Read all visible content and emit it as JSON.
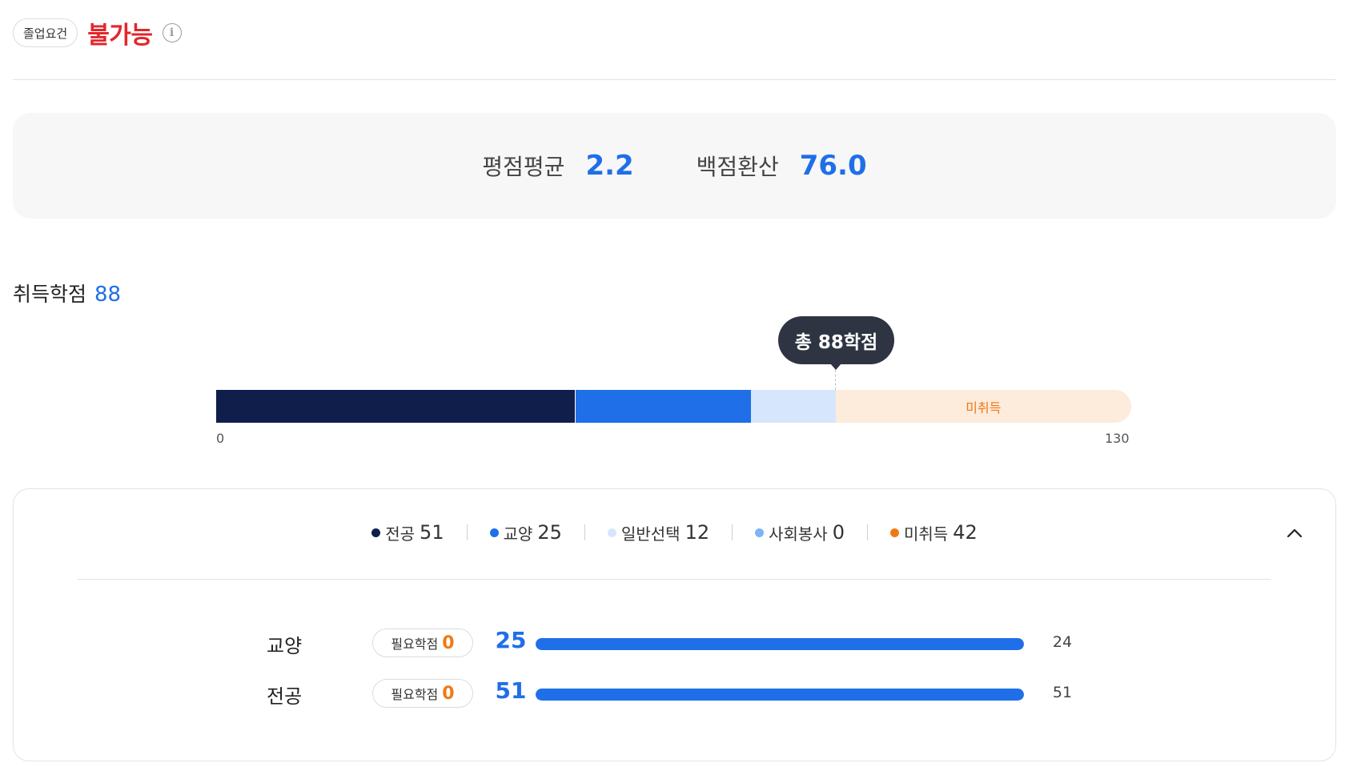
{
  "graduation": {
    "chip_label": "졸업요건",
    "status": "불가능",
    "info_icon": "i"
  },
  "gpa": {
    "average_label": "평점평균",
    "average_value": "2.2",
    "hundred_label": "백점환산",
    "hundred_value": "76.0"
  },
  "earned": {
    "label": "취득학점",
    "value": "88"
  },
  "credit_bar": {
    "tooltip": "총 88학점",
    "missing_label": "미취득",
    "axis_min": "0",
    "axis_max": "130",
    "total": 130,
    "segments": [
      {
        "key": "major",
        "value": 51,
        "color": "#0f1e4b"
      },
      {
        "key": "liberal",
        "value": 25,
        "color": "#1f6fe8"
      },
      {
        "key": "general",
        "value": 12,
        "color": "#d6e6fc"
      },
      {
        "key": "service",
        "value": 0,
        "color": "#7db4f3"
      },
      {
        "key": "missing",
        "value": 42,
        "color": "#fdebdc"
      }
    ]
  },
  "legend": [
    {
      "label": "전공",
      "value": "51",
      "color": "#0f1e4b"
    },
    {
      "label": "교양",
      "value": "25",
      "color": "#1f6fe8"
    },
    {
      "label": "일반선택",
      "value": "12",
      "color": "#d6e6fc"
    },
    {
      "label": "사회봉사",
      "value": "0",
      "color": "#7db4f3"
    },
    {
      "label": "미취득",
      "value": "42",
      "color": "#ef7a15"
    }
  ],
  "detail_rows": [
    {
      "name": "교양",
      "required_label": "필요학점",
      "required_value": "0",
      "earned": "25",
      "requirement": "24",
      "fill_fraction": 1.0
    },
    {
      "name": "전공",
      "required_label": "필요학점",
      "required_value": "0",
      "earned": "51",
      "requirement": "51",
      "fill_fraction": 1.0
    }
  ],
  "icons": {
    "info": "info-circle-icon",
    "collapse": "chevron-up-icon"
  }
}
